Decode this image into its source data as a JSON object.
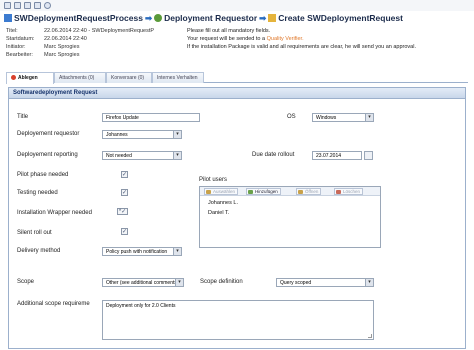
{
  "toolbar": {
    "icons": [
      "save-icon",
      "refresh-icon",
      "print-icon",
      "mail-icon",
      "help-icon"
    ]
  },
  "header": {
    "step1": "SWDeploymentRequestProcess",
    "step2": "Deployment Requestor",
    "step3": "Create SWDeploymentRequest",
    "meta": [
      {
        "label": "Titel:",
        "value": "22.06.2014 22:40 - SWDeploymentRequestP"
      },
      {
        "label": "Startdatum:",
        "value": "22.06.2014 22:40"
      },
      {
        "label": "Initiator:",
        "value": "Marc Sprogies"
      },
      {
        "label": "Bearbeiter:",
        "value": "Marc Sprogies"
      }
    ],
    "info_line1": "Please fill out all mandatory fields.",
    "info_line2_prefix": "Your request will be sended to a ",
    "info_line2_link": "Quality Verifier.",
    "info_line3": "If the installation Package is valid and all requirements are clear, he will send you an approval."
  },
  "tabs": [
    "Ablegen",
    "Attachments (0)",
    "Konversare (0)",
    "Internes Verhalten"
  ],
  "panel": {
    "title": "Softwaredeployment Request"
  },
  "form": {
    "title_label": "Title",
    "title_value": "Firefox Update",
    "os_label": "OS",
    "os_value": "Windows",
    "requestor_label": "Deployement requestor",
    "requestor_value": "Johannes",
    "reporting_label": "Deployement reporting",
    "reporting_value": "Not needed",
    "due_label": "Due date rollout",
    "due_value": "23.07.2014",
    "pilot_phase_label": "Pilot phase needed",
    "testing_label": "Testing needed",
    "wrapper_label": "Installation Wrapper needed",
    "silent_label": "Silent roll out",
    "delivery_label": "Delivery method",
    "delivery_value": "Policy push with notification",
    "pilot_users_label": "Pilot users",
    "pilot_buttons": [
      "Auswählen",
      "Hinzufügen",
      "Öffnen",
      "Löschen"
    ],
    "pilot_users": [
      "Johannes L.",
      "Daniel T."
    ],
    "scope_label": "Scope",
    "scope_value": "Other (see additional comments)",
    "scope_def_label": "Scope definition",
    "scope_def_value": "Query scoped",
    "additional_label": "Additional scope requireme",
    "additional_value": "Deployment only for 2.0 Clients",
    "check_mark": "✓",
    "wrapper_mark": "*✓"
  },
  "colors": {
    "accent": "#15326b",
    "link": "#e0782a",
    "required_dot": "#d8402c"
  }
}
